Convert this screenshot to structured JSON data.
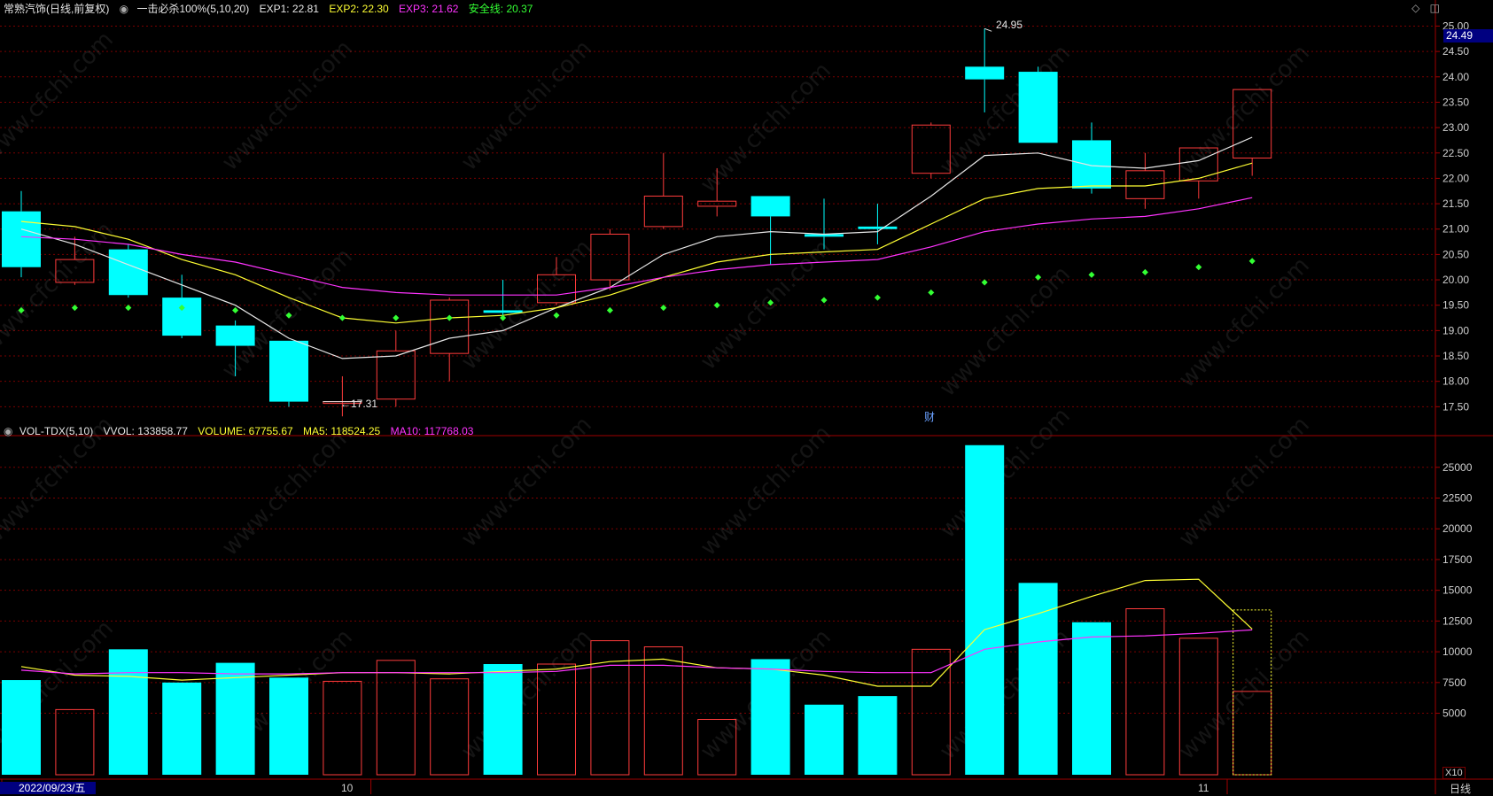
{
  "header": {
    "title": "常熟汽饰(日线,前复权)",
    "indicator_name": "一击必杀100%(5,10,20)",
    "exp1": "EXP1: 22.81",
    "exp2": "EXP2: 22.30",
    "exp3": "EXP3: 21.62",
    "safe_line": "安全线: 20.37"
  },
  "vol_header": {
    "name": "VOL-TDX(5,10)",
    "vvol": "VVOL: 133858.77",
    "volume": "VOLUME: 67755.67",
    "ma5": "MA5: 118524.25",
    "ma10": "MA10: 117768.03"
  },
  "price_badge": "24.49",
  "high_label": "24.95",
  "low_label": "←17.31",
  "fin_marker": "财",
  "x10_label": "X10",
  "period_label": "日线",
  "date_labels": [
    "2022/09/23/五",
    "10",
    "11"
  ],
  "watermark": "www.cfchi.com",
  "colors": {
    "up": "#ff3b3b",
    "down": "#00ffff",
    "ma_white": "#e6e6e6",
    "ma_yellow": "#ffff33",
    "ma_magenta": "#ff33ff",
    "safe": "#33ff33",
    "grid": "#7a0000",
    "axis_text": "#d0d0d0"
  },
  "chart_data": [
    {
      "type": "candlestick",
      "title": "常熟汽饰(日线,前复权)",
      "ylim": [
        17.0,
        25.2
      ],
      "y_ticks": [
        "25.00",
        "24.50",
        "24.00",
        "23.50",
        "23.00",
        "22.50",
        "22.00",
        "21.50",
        "21.00",
        "20.50",
        "20.00",
        "19.50",
        "19.00",
        "18.50",
        "18.00",
        "17.50"
      ],
      "candles": [
        {
          "o": 21.35,
          "h": 21.75,
          "l": 20.05,
          "c": 20.25
        },
        {
          "o": 19.95,
          "h": 20.85,
          "l": 19.9,
          "c": 20.4
        },
        {
          "o": 20.6,
          "h": 20.7,
          "l": 19.65,
          "c": 19.7
        },
        {
          "o": 19.65,
          "h": 20.1,
          "l": 18.85,
          "c": 18.9
        },
        {
          "o": 19.1,
          "h": 19.2,
          "l": 18.1,
          "c": 18.7
        },
        {
          "o": 18.8,
          "h": 18.8,
          "l": 17.5,
          "c": 17.6
        },
        {
          "o": 17.6,
          "h": 18.1,
          "l": 17.31,
          "c": 17.6
        },
        {
          "o": 17.65,
          "h": 19.0,
          "l": 17.5,
          "c": 18.6
        },
        {
          "o": 18.55,
          "h": 19.65,
          "l": 18.0,
          "c": 19.6
        },
        {
          "o": 19.4,
          "h": 20.0,
          "l": 19.2,
          "c": 19.35
        },
        {
          "o": 19.55,
          "h": 20.45,
          "l": 19.5,
          "c": 20.1
        },
        {
          "o": 20.0,
          "h": 21.0,
          "l": 19.8,
          "c": 20.9
        },
        {
          "o": 21.05,
          "h": 22.5,
          "l": 21.0,
          "c": 21.65
        },
        {
          "o": 21.45,
          "h": 22.2,
          "l": 21.25,
          "c": 21.55
        },
        {
          "o": 21.65,
          "h": 21.65,
          "l": 20.3,
          "c": 21.25
        },
        {
          "o": 20.9,
          "h": 21.6,
          "l": 20.6,
          "c": 20.85
        },
        {
          "o": 21.05,
          "h": 21.5,
          "l": 20.7,
          "c": 21.0
        },
        {
          "o": 22.1,
          "h": 23.1,
          "l": 22.0,
          "c": 23.05
        },
        {
          "o": 24.2,
          "h": 24.95,
          "l": 23.3,
          "c": 23.95
        },
        {
          "o": 24.1,
          "h": 24.2,
          "l": 22.7,
          "c": 22.7
        },
        {
          "o": 22.75,
          "h": 23.1,
          "l": 21.7,
          "c": 21.8
        },
        {
          "o": 21.6,
          "h": 22.5,
          "l": 21.4,
          "c": 22.15
        },
        {
          "o": 21.95,
          "h": 22.6,
          "l": 21.6,
          "c": 22.6
        },
        {
          "o": 22.4,
          "h": 23.75,
          "l": 22.05,
          "c": 23.75
        }
      ],
      "series": [
        {
          "name": "EXP1",
          "values": [
            21.0,
            20.7,
            20.3,
            19.9,
            19.5,
            18.85,
            18.45,
            18.5,
            18.85,
            19.0,
            19.45,
            19.85,
            20.5,
            20.85,
            20.95,
            20.9,
            20.95,
            21.65,
            22.45,
            22.5,
            22.25,
            22.2,
            22.35,
            22.81
          ]
        },
        {
          "name": "EXP2",
          "values": [
            21.15,
            21.05,
            20.8,
            20.4,
            20.1,
            19.65,
            19.25,
            19.15,
            19.25,
            19.3,
            19.45,
            19.7,
            20.05,
            20.35,
            20.5,
            20.55,
            20.6,
            21.1,
            21.6,
            21.8,
            21.85,
            21.85,
            22.0,
            22.3
          ]
        },
        {
          "name": "EXP3",
          "values": [
            20.85,
            20.8,
            20.7,
            20.5,
            20.35,
            20.1,
            19.85,
            19.75,
            19.7,
            19.7,
            19.7,
            19.85,
            20.05,
            20.2,
            20.3,
            20.35,
            20.4,
            20.65,
            20.95,
            21.1,
            21.2,
            21.25,
            21.4,
            21.62
          ]
        },
        {
          "name": "安全线",
          "values": [
            19.4,
            19.45,
            19.45,
            19.45,
            19.4,
            19.3,
            19.25,
            19.25,
            19.25,
            19.25,
            19.3,
            19.4,
            19.45,
            19.5,
            19.55,
            19.6,
            19.65,
            19.75,
            19.95,
            20.05,
            20.1,
            20.15,
            20.25,
            20.37
          ]
        }
      ]
    },
    {
      "type": "bar",
      "title": "VOL-TDX(5,10)",
      "ylim": [
        0,
        27000
      ],
      "y_ticks": [
        "25000",
        "22500",
        "20000",
        "17500",
        "15000",
        "12500",
        "10000",
        "7500",
        "5000"
      ],
      "values": [
        7700,
        5300,
        10200,
        7500,
        9100,
        7900,
        7600,
        9300,
        7800,
        9000,
        9000,
        10900,
        10400,
        4500,
        9400,
        5700,
        6400,
        10200,
        26800,
        15600,
        12400,
        13500,
        11100,
        6776
      ],
      "directions": [
        "down",
        "up",
        "down",
        "down",
        "down",
        "down",
        "up",
        "up",
        "up",
        "down",
        "up",
        "up",
        "up",
        "up",
        "down",
        "down",
        "down",
        "up",
        "down",
        "down",
        "down",
        "up",
        "up",
        "up"
      ],
      "series": [
        {
          "name": "MA5",
          "values": [
            8800,
            8100,
            8000,
            7700,
            7900,
            8100,
            8300,
            8300,
            8200,
            8400,
            8600,
            9200,
            9400,
            8700,
            8600,
            8100,
            7200,
            7200,
            11800,
            13100,
            14500,
            15800,
            15900,
            11852
          ]
        },
        {
          "name": "MA10",
          "values": [
            8500,
            8200,
            8300,
            8300,
            8200,
            8200,
            8300,
            8300,
            8300,
            8300,
            8400,
            8900,
            8900,
            8700,
            8600,
            8400,
            8300,
            8300,
            10200,
            10800,
            11200,
            11300,
            11500,
            11777
          ]
        }
      ]
    }
  ]
}
